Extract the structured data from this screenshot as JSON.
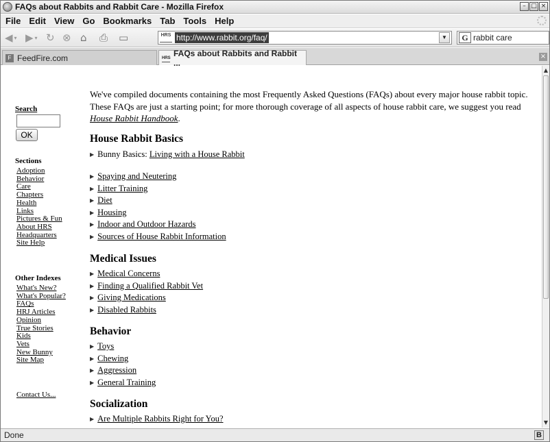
{
  "window": {
    "title": "FAQs about Rabbits and Rabbit Care - Mozilla Firefox",
    "controls": [
      "minimize-icon",
      "maximize-icon",
      "close-icon"
    ]
  },
  "menubar": {
    "items": [
      "File",
      "Edit",
      "View",
      "Go",
      "Bookmarks",
      "Tab",
      "Tools",
      "Help"
    ]
  },
  "navbar": {
    "url": "http://www.rabbit.org/faq/",
    "site_icon_text": "HRS",
    "search_value": "rabbit care",
    "search_engine_glyph": "G"
  },
  "tabs": [
    {
      "label": "FeedFire.com",
      "favicon": "F",
      "active": false
    },
    {
      "label": "FAQs about Rabbits and Rabbit ...",
      "favicon": "HRS",
      "active": true
    }
  ],
  "sidebar": {
    "search_heading": "Search",
    "ok_label": "OK",
    "sections_heading": "Sections",
    "sections": [
      "Adoption",
      "Behavior",
      "Care",
      "Chapters",
      "Health",
      "Links",
      "Pictures & Fun",
      "About HRS",
      "Headquarters",
      "Site Help"
    ],
    "other_heading": "Other Indexes",
    "other": [
      "What's New?",
      "What's Popular?",
      "FAQs",
      "HRJ Articles",
      "Opinion",
      "True Stories",
      "Kids",
      "Vets",
      "New Bunny",
      "Site Map"
    ],
    "contact": "Contact Us..."
  },
  "main": {
    "intro_text": "We've compiled documents containing the most Frequently Asked Questions (FAQs) about every major house rabbit topic. These FAQs are just a starting point; for more thorough coverage of all aspects of house rabbit care, we suggest you read ",
    "intro_link": "House Rabbit Handbook",
    "intro_end": ".",
    "sections": [
      {
        "heading": "House Rabbit Basics",
        "first_prefix": "Bunny Basics: ",
        "first_link": "Living with a House Rabbit",
        "items": [
          "Spaying and Neutering",
          "Litter Training",
          "Diet",
          "Housing",
          "Indoor and Outdoor Hazards",
          "Sources of House Rabbit Information"
        ]
      },
      {
        "heading": "Medical Issues",
        "items": [
          "Medical Concerns",
          "Finding a Qualified Rabbit Vet",
          "Giving Medications",
          "Disabled Rabbits"
        ]
      },
      {
        "heading": "Behavior",
        "items": [
          "Toys",
          "Chewing",
          "Aggression",
          "General Training"
        ]
      },
      {
        "heading": "Socialization",
        "items": [
          "Are Multiple Rabbits Right for You?"
        ]
      }
    ]
  },
  "status": {
    "text": "Done",
    "right_icon": "B"
  }
}
